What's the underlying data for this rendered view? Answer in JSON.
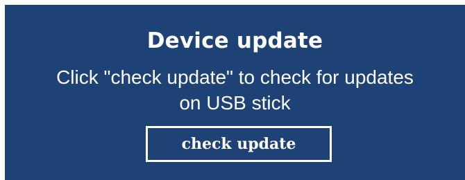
{
  "panel": {
    "background_color": "#1f4276",
    "title": "Device update",
    "description": "Click \"check update\" to check for updates on USB stick",
    "button_label": "check update"
  }
}
